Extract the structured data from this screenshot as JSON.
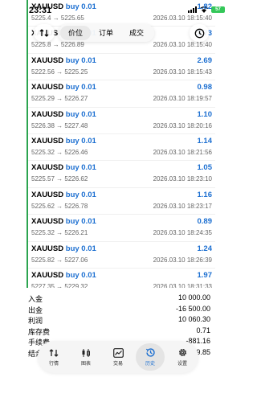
{
  "status_bar": {
    "time": "23:31",
    "battery": "57"
  },
  "tabs": {
    "items": [
      "价位",
      "订单",
      "成交"
    ],
    "active_index": 0
  },
  "trades": [
    {
      "symbol": "XAUUSD",
      "side": "buy 0.01",
      "profit": "1.82",
      "prices": "5225.4 → 5225.65",
      "datetime": "2026.03.10 18:15:40"
    },
    {
      "symbol": "XAUUSD",
      "side": "buy 0.01",
      "profit": "2.73",
      "prices": "5225.8 → 5226.89",
      "datetime": "2026.03.10 18:15:40"
    },
    {
      "symbol": "XAUUSD",
      "side": "buy 0.01",
      "profit": "2.69",
      "prices": "5222.56 → 5225.25",
      "datetime": "2026.03.10 18:15:43"
    },
    {
      "symbol": "XAUUSD",
      "side": "buy 0.01",
      "profit": "0.98",
      "prices": "5225.29 → 5226.27",
      "datetime": "2026.03.10 18:19:57"
    },
    {
      "symbol": "XAUUSD",
      "side": "buy 0.01",
      "profit": "1.10",
      "prices": "5226.38 → 5227.48",
      "datetime": "2026.03.10 18:20:16"
    },
    {
      "symbol": "XAUUSD",
      "side": "buy 0.01",
      "profit": "1.14",
      "prices": "5225.32 → 5226.46",
      "datetime": "2026.03.10 18:21:56"
    },
    {
      "symbol": "XAUUSD",
      "side": "buy 0.01",
      "profit": "1.05",
      "prices": "5225.57 → 5226.62",
      "datetime": "2026.03.10 18:23:10"
    },
    {
      "symbol": "XAUUSD",
      "side": "buy 0.01",
      "profit": "1.16",
      "prices": "5225.62 → 5226.78",
      "datetime": "2026.03.10 18:23:17"
    },
    {
      "symbol": "XAUUSD",
      "side": "buy 0.01",
      "profit": "0.89",
      "prices": "5225.32 → 5226.21",
      "datetime": "2026.03.10 18:24:35"
    },
    {
      "symbol": "XAUUSD",
      "side": "buy 0.01",
      "profit": "1.24",
      "prices": "5225.82 → 5227.06",
      "datetime": "2026.03.10 18:26:39"
    },
    {
      "symbol": "XAUUSD",
      "side": "buy 0.01",
      "profit": "1.97",
      "prices": "5227.35 → 5229.32",
      "datetime": "2026.03.10 18:31:33"
    }
  ],
  "summary": [
    {
      "label": "入金",
      "value": "10 000.00"
    },
    {
      "label": "出金",
      "value": "-16 500.00"
    },
    {
      "label": "利润",
      "value": "10 060.30"
    },
    {
      "label": "库存费",
      "value": "0.71"
    },
    {
      "label": "手续费",
      "value": "-881.16"
    },
    {
      "label": "结余",
      "value": "2 679.85"
    }
  ],
  "nav": {
    "items": [
      "行情",
      "图表",
      "交易",
      "历史",
      "设置"
    ],
    "active_index": 3
  },
  "colors": {
    "accent": "#1c6fd1",
    "list_border": "#2ca44f",
    "battery": "#34c759"
  }
}
